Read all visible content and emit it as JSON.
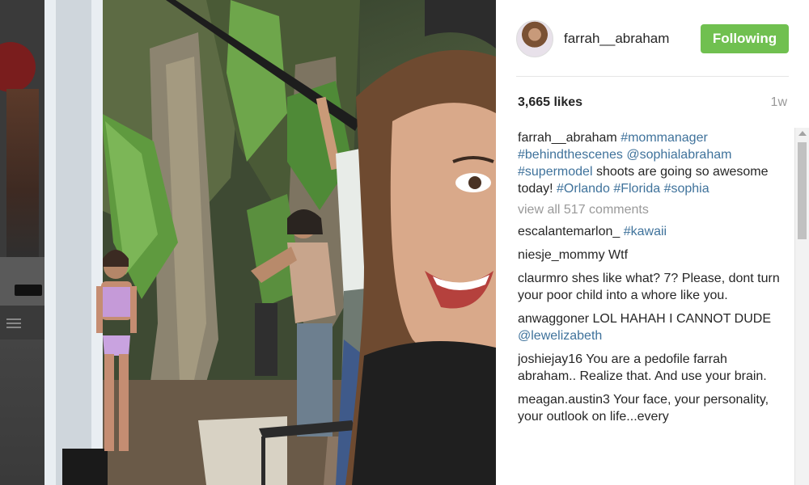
{
  "post": {
    "username": "farrah__abraham",
    "follow_label": "Following",
    "likes": "3,665 likes",
    "age": "1w",
    "caption": {
      "user": "farrah__abraham",
      "segments": [
        {
          "text": "#mommanager",
          "tag": true
        },
        {
          "text": " ",
          "tag": false
        },
        {
          "text": "#behindthescenes",
          "tag": true
        },
        {
          "text": " ",
          "tag": false
        },
        {
          "text": "@sophialabraham",
          "tag": true
        },
        {
          "text": " ",
          "tag": false
        },
        {
          "text": "#supermodel",
          "tag": true
        },
        {
          "text": " shoots are going so awesome today! ",
          "tag": false
        },
        {
          "text": "#Orlando",
          "tag": true
        },
        {
          "text": " ",
          "tag": false
        },
        {
          "text": "#Florida",
          "tag": true
        },
        {
          "text": " ",
          "tag": false
        },
        {
          "text": "#sophia",
          "tag": true
        }
      ]
    },
    "view_all": "view all 517 comments",
    "comments": [
      {
        "user": "escalantemarlon_",
        "segments": [
          {
            "text": "#kawaii",
            "tag": true
          }
        ]
      },
      {
        "user": "niesje_mommy",
        "segments": [
          {
            "text": "Wtf",
            "tag": false
          }
        ]
      },
      {
        "user": "claurmro",
        "segments": [
          {
            "text": "shes like what? 7? Please, dont turn your poor child into a whore like you.",
            "tag": false
          }
        ]
      },
      {
        "user": "anwaggoner",
        "segments": [
          {
            "text": "LOL HAHAH I CANNOT DUDE ",
            "tag": false
          },
          {
            "text": "@lewelizabeth",
            "tag": true
          }
        ]
      },
      {
        "user": "joshiejay16",
        "segments": [
          {
            "text": "You are a pedofile farrah abraham.. Realize that. And use your brain.",
            "tag": false
          }
        ]
      },
      {
        "user": "meagan.austin3",
        "segments": [
          {
            "text": "Your face, your personality, your outlook on life...every",
            "tag": false
          }
        ]
      }
    ]
  },
  "icons": {
    "avatar": "profile-photo",
    "scroll": "scrollbar"
  },
  "colors": {
    "follow_button": "#70c050",
    "tag": "#3f729b",
    "muted": "#999999"
  }
}
